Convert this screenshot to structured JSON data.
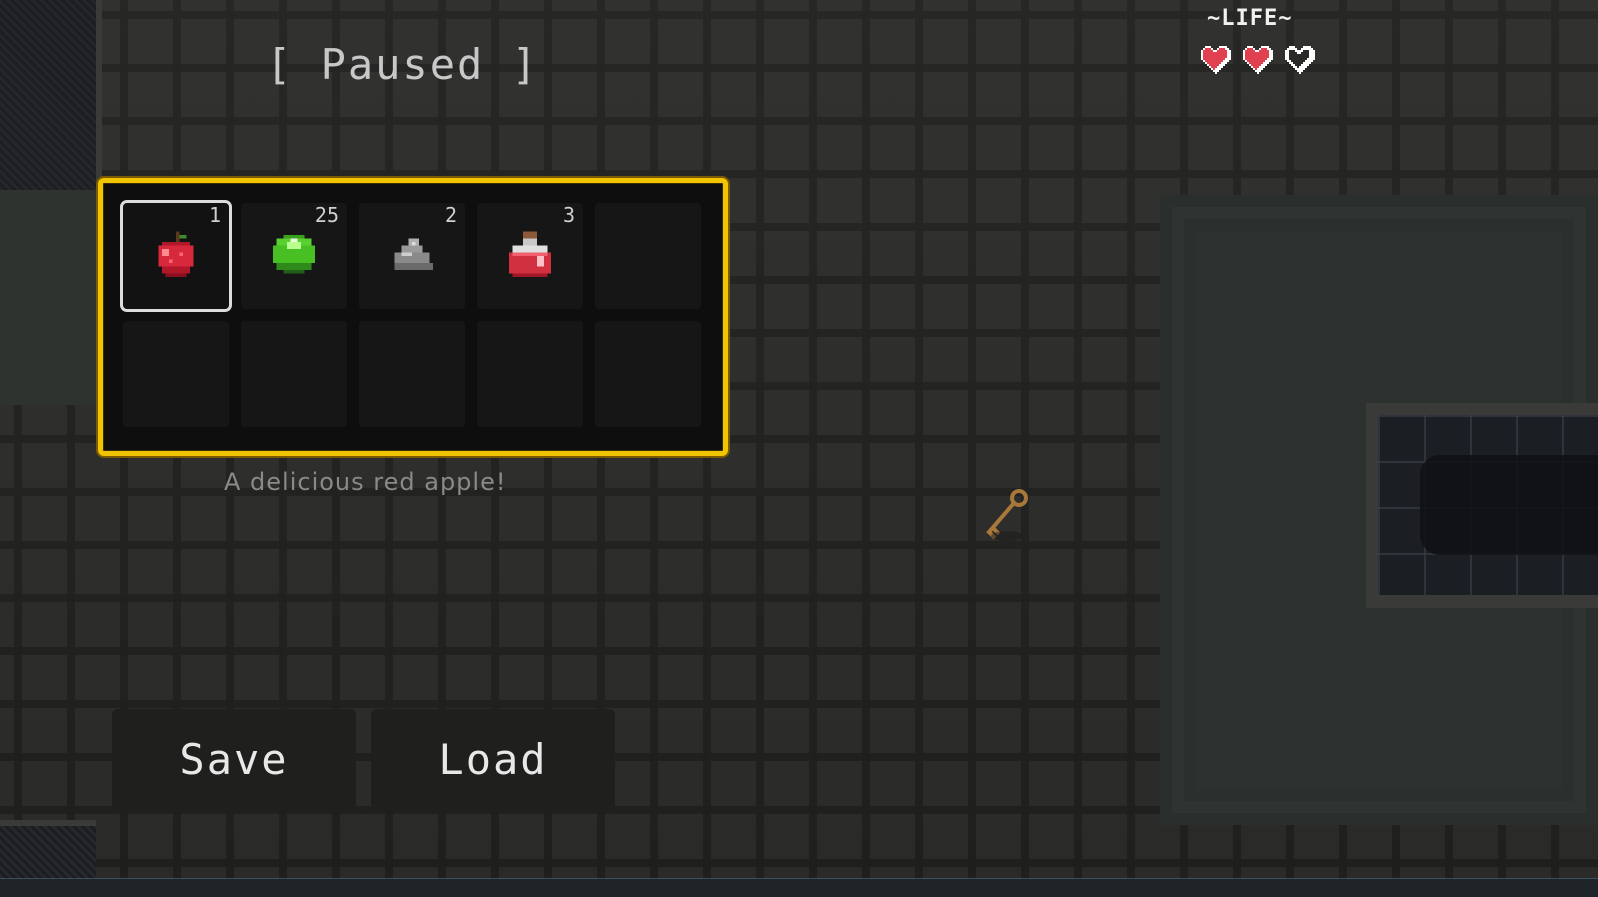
{
  "hud": {
    "pause_title": "[ Paused ]",
    "life_label": "~LIFE~",
    "hearts": {
      "full": 2,
      "max": 3
    }
  },
  "inventory": {
    "selected_index": 0,
    "slots": [
      {
        "item": "apple-icon",
        "count": "1"
      },
      {
        "item": "green-orb-icon",
        "count": "25"
      },
      {
        "item": "stone-icon",
        "count": "2"
      },
      {
        "item": "red-potion-icon",
        "count": "3"
      },
      {
        "item": "",
        "count": ""
      },
      {
        "item": "",
        "count": ""
      },
      {
        "item": "",
        "count": ""
      },
      {
        "item": "",
        "count": ""
      },
      {
        "item": "",
        "count": ""
      },
      {
        "item": "",
        "count": ""
      }
    ],
    "description": "A delicious red apple!"
  },
  "menu": {
    "save_label": "Save",
    "load_label": "Load"
  },
  "colors": {
    "inventory_border": "#f0c400",
    "heart_full": "#e0404f",
    "heart_empty_outline": "#ffffff"
  }
}
